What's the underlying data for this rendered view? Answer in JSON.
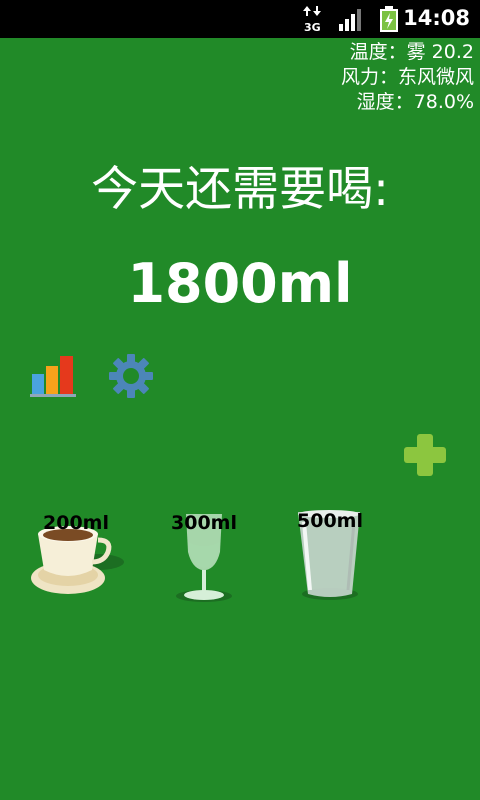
{
  "status_bar": {
    "network": "3G",
    "time": "14:08"
  },
  "weather": {
    "temperature": "温度：雾 20.2",
    "wind": "风力：东风微风",
    "humidity": "湿度：78.0%"
  },
  "main": {
    "headline": "今天还需要喝:",
    "amount": "1800ml"
  },
  "vessels": [
    {
      "label": "200ml",
      "icon": "coffee-cup-icon"
    },
    {
      "label": "300ml",
      "icon": "wine-glass-icon"
    },
    {
      "label": "500ml",
      "icon": "tumbler-glass-icon"
    }
  ],
  "colors": {
    "background": "#218a28",
    "status_bar": "#000000",
    "add_icon": "#8cc63f"
  }
}
